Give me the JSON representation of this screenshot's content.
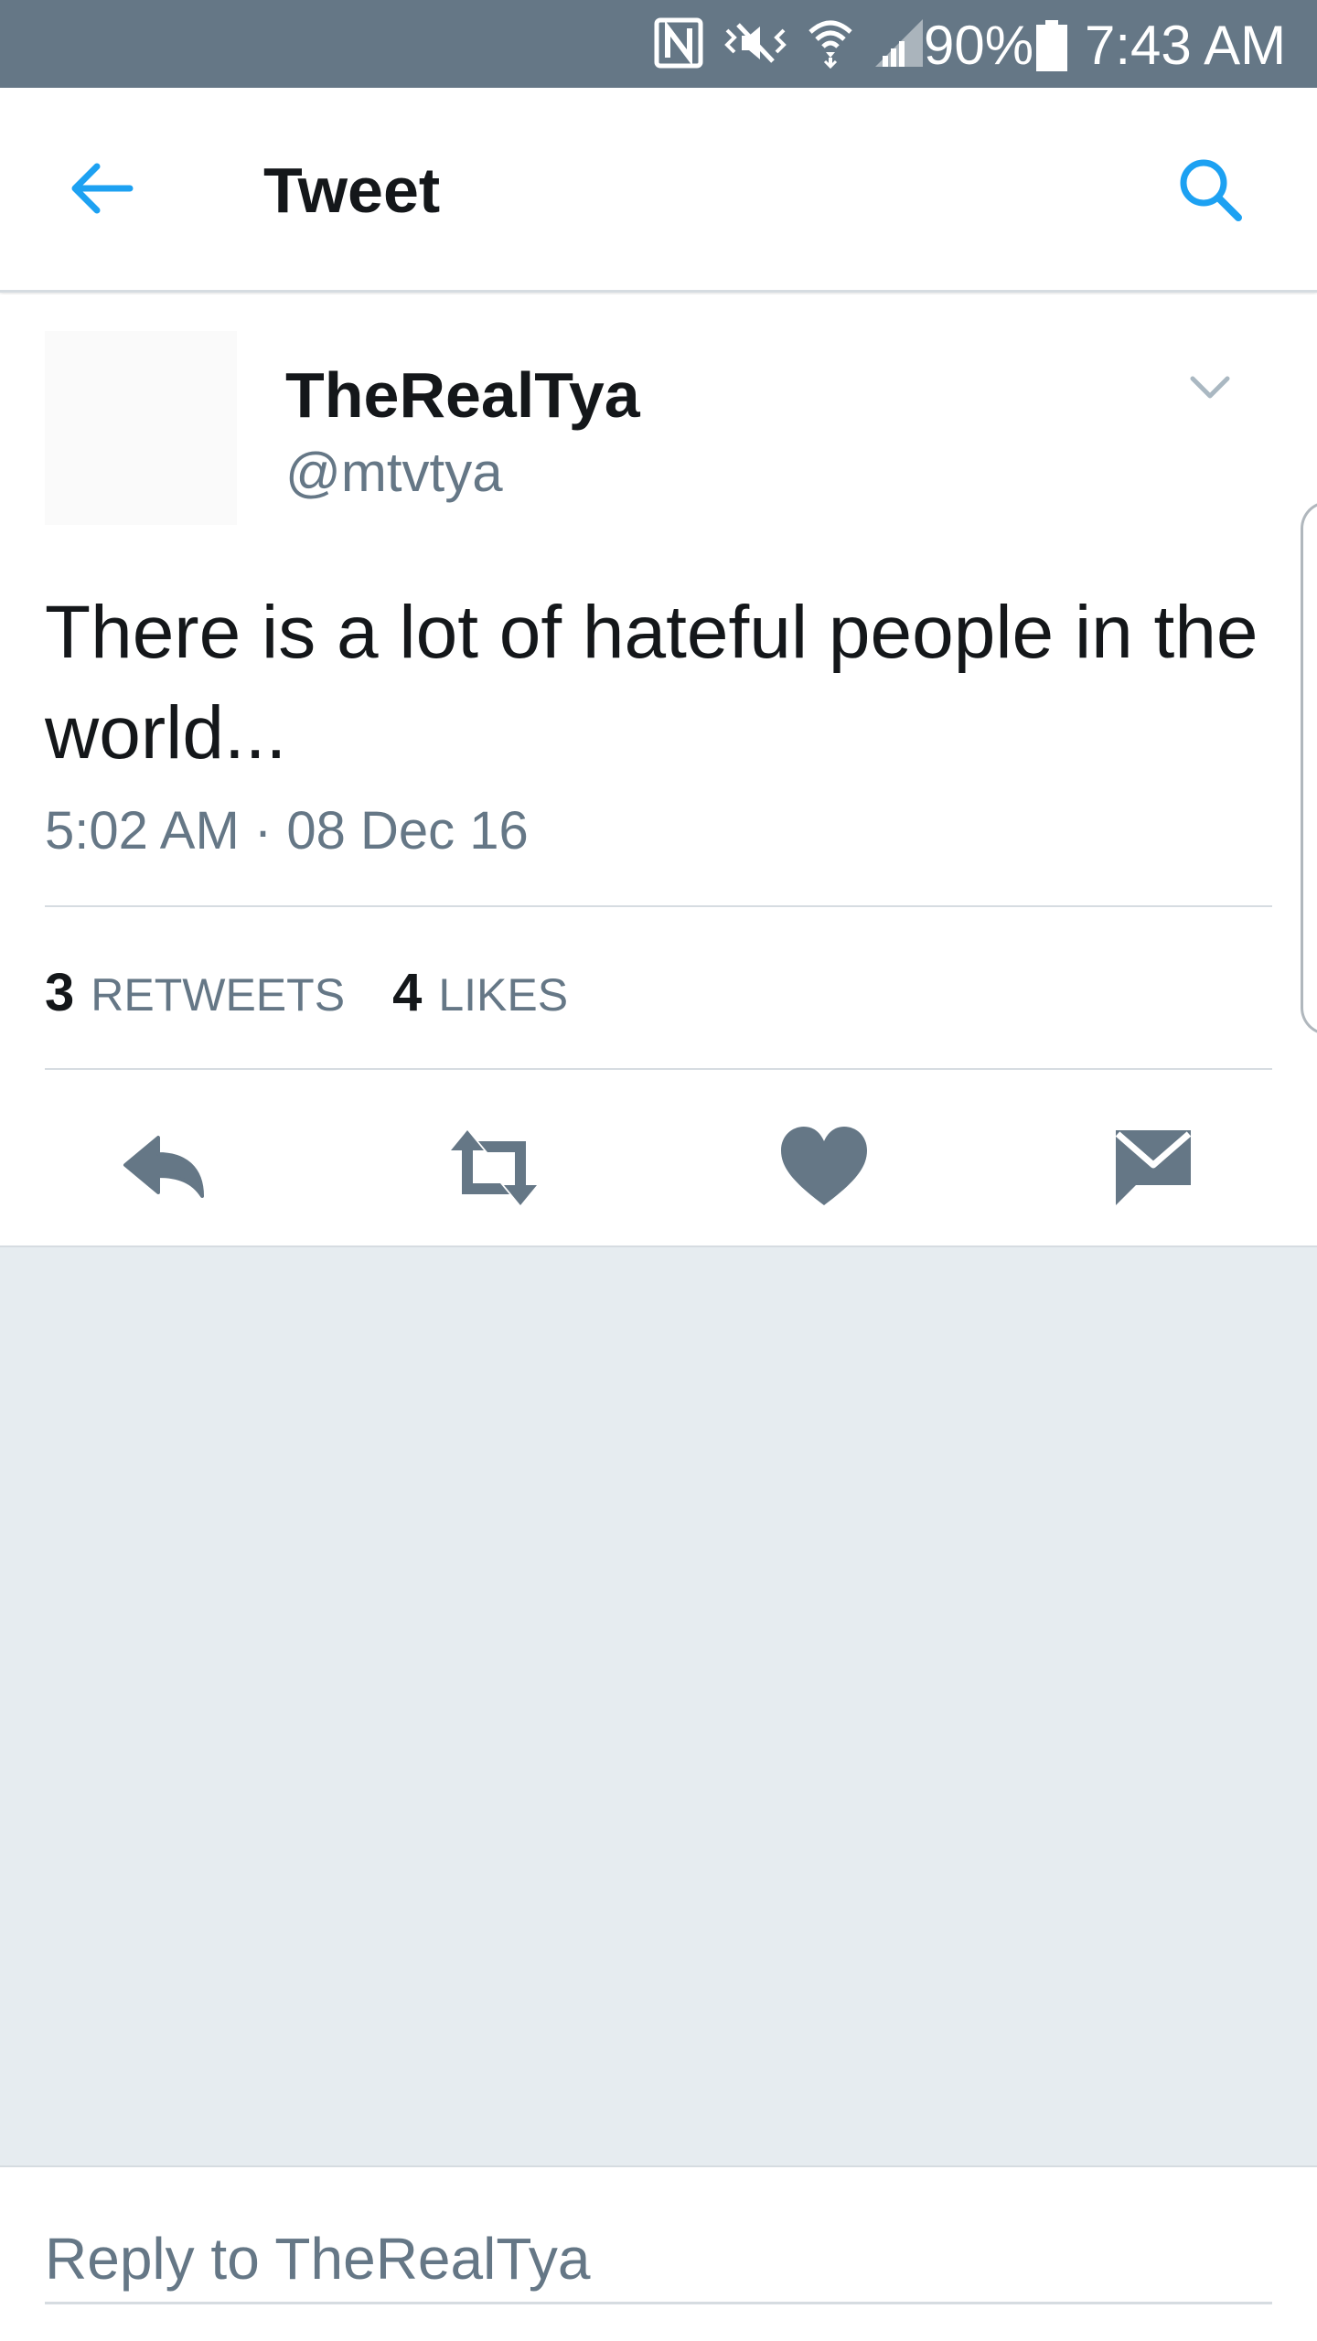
{
  "status_bar": {
    "battery_percent": "90%",
    "time": "7:43 AM",
    "icons": [
      "nfc-icon",
      "vibrate-icon",
      "wifi-icon",
      "signal-icon",
      "battery-icon"
    ]
  },
  "app_bar": {
    "title": "Tweet",
    "back_icon": "arrow-left-icon",
    "search_icon": "search-icon",
    "accent_color": "#1da1f2"
  },
  "tweet": {
    "display_name": "TheRealTya",
    "handle": "@mtvtya",
    "text": "There is a lot of hateful people in the world...",
    "timestamp": "5:02 AM · 08 Dec 16",
    "retweets_count": "3",
    "retweets_label": "RETWEETS",
    "likes_count": "4",
    "likes_label": "LIKES",
    "actions": [
      "reply-icon",
      "retweet-icon",
      "like-icon",
      "direct-message-icon"
    ]
  },
  "reply": {
    "placeholder": "Reply to TheRealTya"
  },
  "colors": {
    "status_bar_bg": "#657786",
    "secondary_text": "#657786",
    "divider": "#d6dce1",
    "empty_bg": "#e6ecf0"
  }
}
